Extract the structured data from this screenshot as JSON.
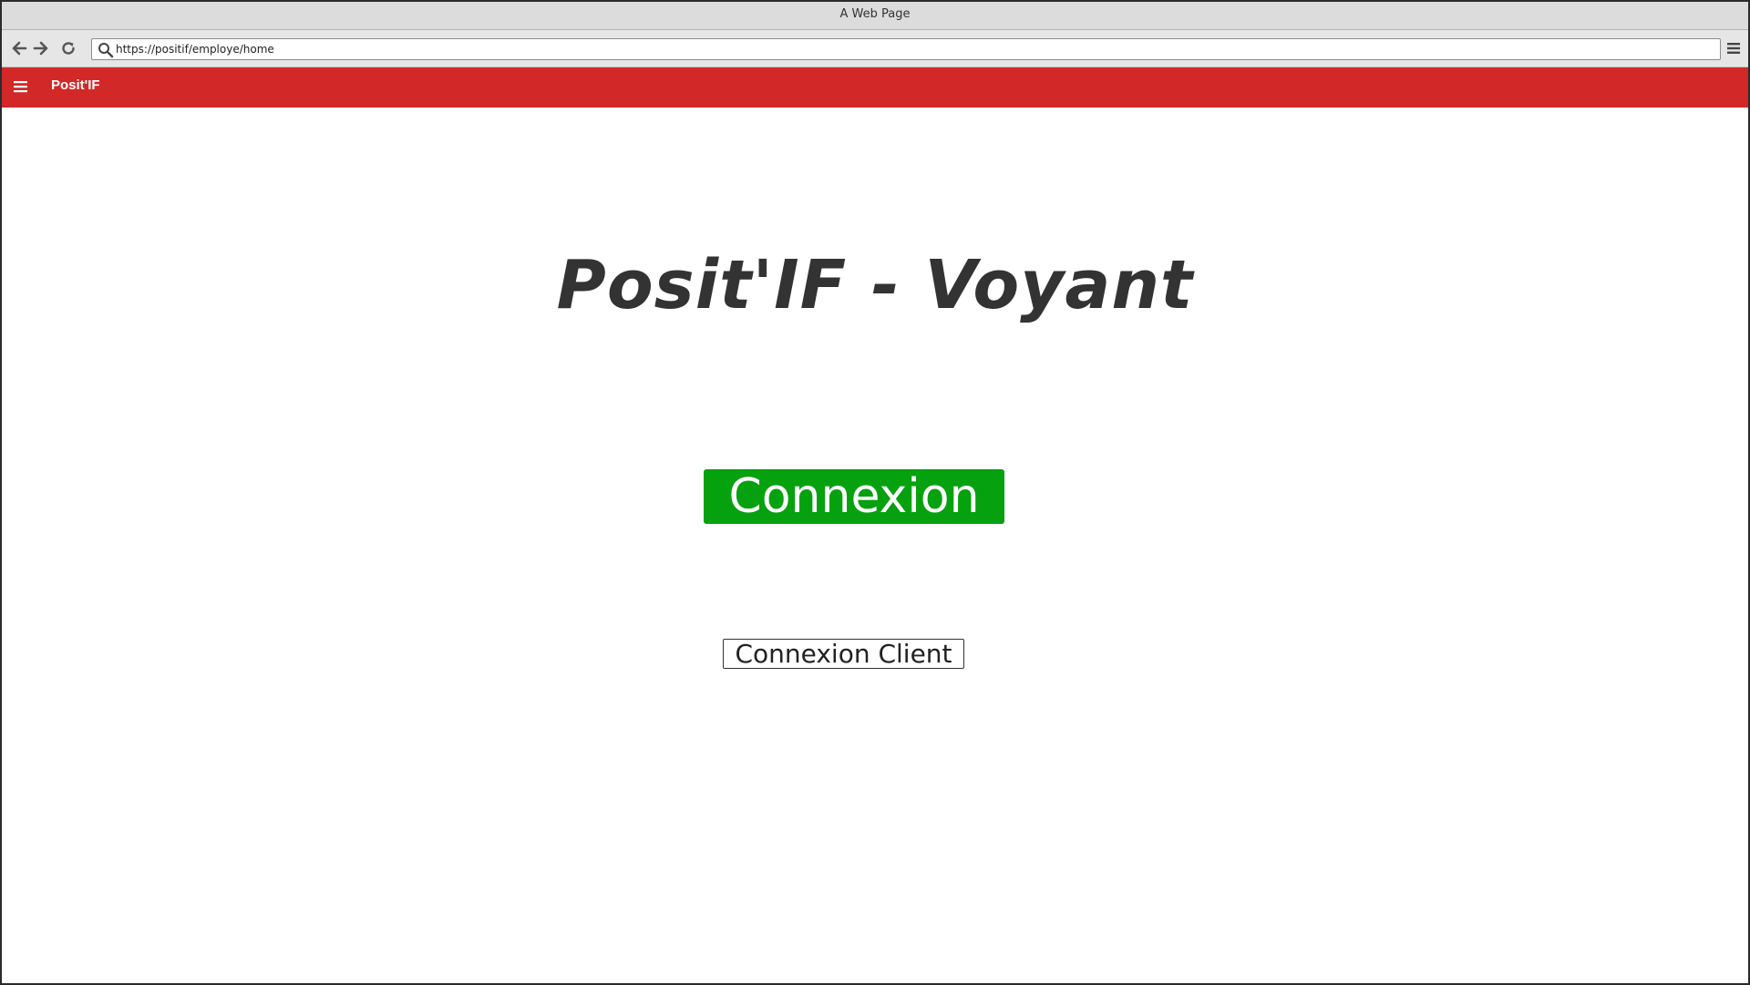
{
  "window": {
    "title": "A Web Page"
  },
  "browser": {
    "url": "https://positif/employe/home",
    "icons": {
      "back": "arrow-left-icon",
      "forward": "arrow-right-icon",
      "reload": "refresh-icon",
      "search": "search-icon",
      "menu": "menu-icon"
    }
  },
  "appbar": {
    "title": "Posit'IF",
    "color": "#d22828"
  },
  "main": {
    "headline": "Posit'IF - Voyant",
    "primary_button": "Connexion",
    "primary_color": "#06a10f",
    "secondary_button": "Connexion Client"
  }
}
